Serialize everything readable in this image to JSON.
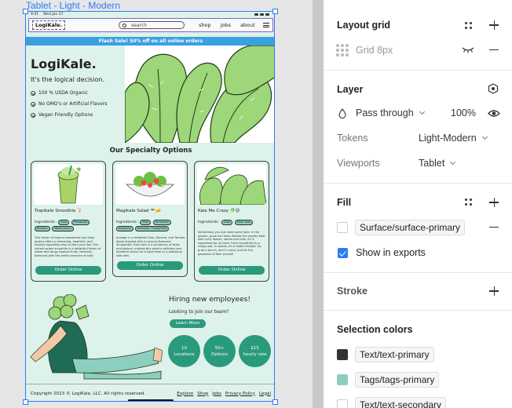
{
  "canvas": {
    "frame_label": "Tablet - Light - Modern",
    "status_time": "9:41",
    "status_date": "Wed Jan 27",
    "nav": {
      "logo": "LogiKale.",
      "search_placeholder": "search",
      "links": [
        "shop",
        "jobs",
        "about"
      ]
    },
    "banner": "Flash Sale! 50% off on all online orders",
    "hero": {
      "title": "LogiKale.",
      "subtitle": "It's the logical decision.",
      "features": [
        "100 % USDA Organic",
        "No GMO's or Artificial Flavors",
        "Vegan Friendly Options"
      ]
    },
    "specialty_title": "Our Specialty Options",
    "cards": [
      {
        "name": "Tropikale Smoothie 🍹",
        "ingredients_label": "Ingredients :",
        "tags": [
          "Kale",
          "Pineapple",
          "Banana",
          "Watermelon"
        ],
        "description": "This fusion of tropical sweetness and leafy greens offers a refreshing, healthful, and visually appealing way to start your day. This vibrant green smoothie is a delightful fusion of sweet and tangy tropical fruits, perfectly balanced with the earthy essence of kale.",
        "button": "Order Online"
      },
      {
        "name": "Magikale Salad 🥗🧀",
        "ingredients_label": "Ingredients :",
        "tags": [
          "Kale",
          "Tomatoes",
          "Almonds",
          "Balsamic Vinaigrette"
        ],
        "description": "Indulge in a delightful Kale, Almond, and Tomato Salad drizzled with a luscious Balsamic Vinaigrette. Each bite is a symphony of taste and texture, making this salad a delicious and healthful choice for a light meal or a satisfying side dish.",
        "button": "Order Online"
      },
      {
        "name": "Kale Me Crazy 🥬😜",
        "ingredients_label": "Ingredients :",
        "tags": [
          "Kale",
          "More Kale"
        ],
        "description": "Sometimes you just need some Kale. In the garden, grow and hate, Blende the mighty Kale, with curly leaves, robust and hale, it's a superfood we all need. From smoothies to a crispy salt, in salads, it's a health delight. So, grab a bunch, don't curtail, And let the goodness of Kale prevail!",
        "button": "Order Online"
      }
    ],
    "hiring": {
      "title": "Hiring new employees!",
      "subtitle": "Looking to join our team?",
      "button": "Learn More",
      "stats": [
        {
          "value": "10",
          "label": "Locations"
        },
        {
          "value": "50+",
          "label": "Options"
        },
        {
          "value": "$15",
          "label": "hourly rate"
        }
      ]
    },
    "footer": {
      "copyright": "Copyright 2023 © LogiKale, LLC. All rights reserved.",
      "links": [
        "Explore",
        "Shop",
        "Jobs",
        "Privacy Policy",
        "Legal"
      ]
    }
  },
  "panel": {
    "layout_grid": {
      "title": "Layout grid",
      "grid_label": "Grid 8px"
    },
    "layer": {
      "title": "Layer",
      "blend_mode": "Pass through",
      "opacity": "100%",
      "tokens_label": "Tokens",
      "tokens_value": "Light-Modern",
      "viewports_label": "Viewports",
      "viewports_value": "Tablet"
    },
    "fill": {
      "title": "Fill",
      "token": "Surface/surface-primary",
      "show_in_exports": "Show in exports"
    },
    "stroke": {
      "title": "Stroke"
    },
    "selection_colors": {
      "title": "Selection colors",
      "items": [
        {
          "name": "Text/text-primary",
          "color": "#333333"
        },
        {
          "name": "Tags/tags-primary",
          "color": "#8dcfbe"
        },
        {
          "name": "Text/text-secondary",
          "color": "#ffffff"
        }
      ]
    }
  }
}
